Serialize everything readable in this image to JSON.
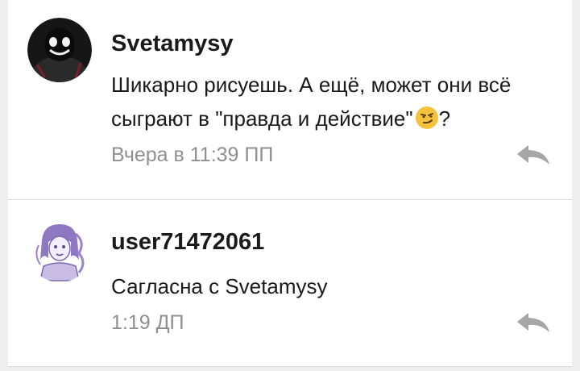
{
  "comments": [
    {
      "username": "Svetamysy",
      "message": "Шикарно рисуешь. А ещё, может они всё сыграют в \"правда и действие\"",
      "message_tail": "?",
      "emoji": "smirk-emoji",
      "timestamp": "Вчера в 11:39 ПП",
      "avatar": "dark-character-avatar",
      "reply_icon": "reply-icon"
    },
    {
      "username": "user71472061",
      "message": "Сагласна с Svetamysy",
      "timestamp": "1:19 ДП",
      "avatar": "purple-sketch-avatar",
      "reply_icon": "reply-icon"
    }
  ],
  "colors": {
    "background": "#eeeeee",
    "card": "#ffffff",
    "text": "#1a1a1a",
    "muted": "#8f8f8f",
    "icon": "#a6a6a6",
    "avatar_purple": "#9b84c9"
  }
}
